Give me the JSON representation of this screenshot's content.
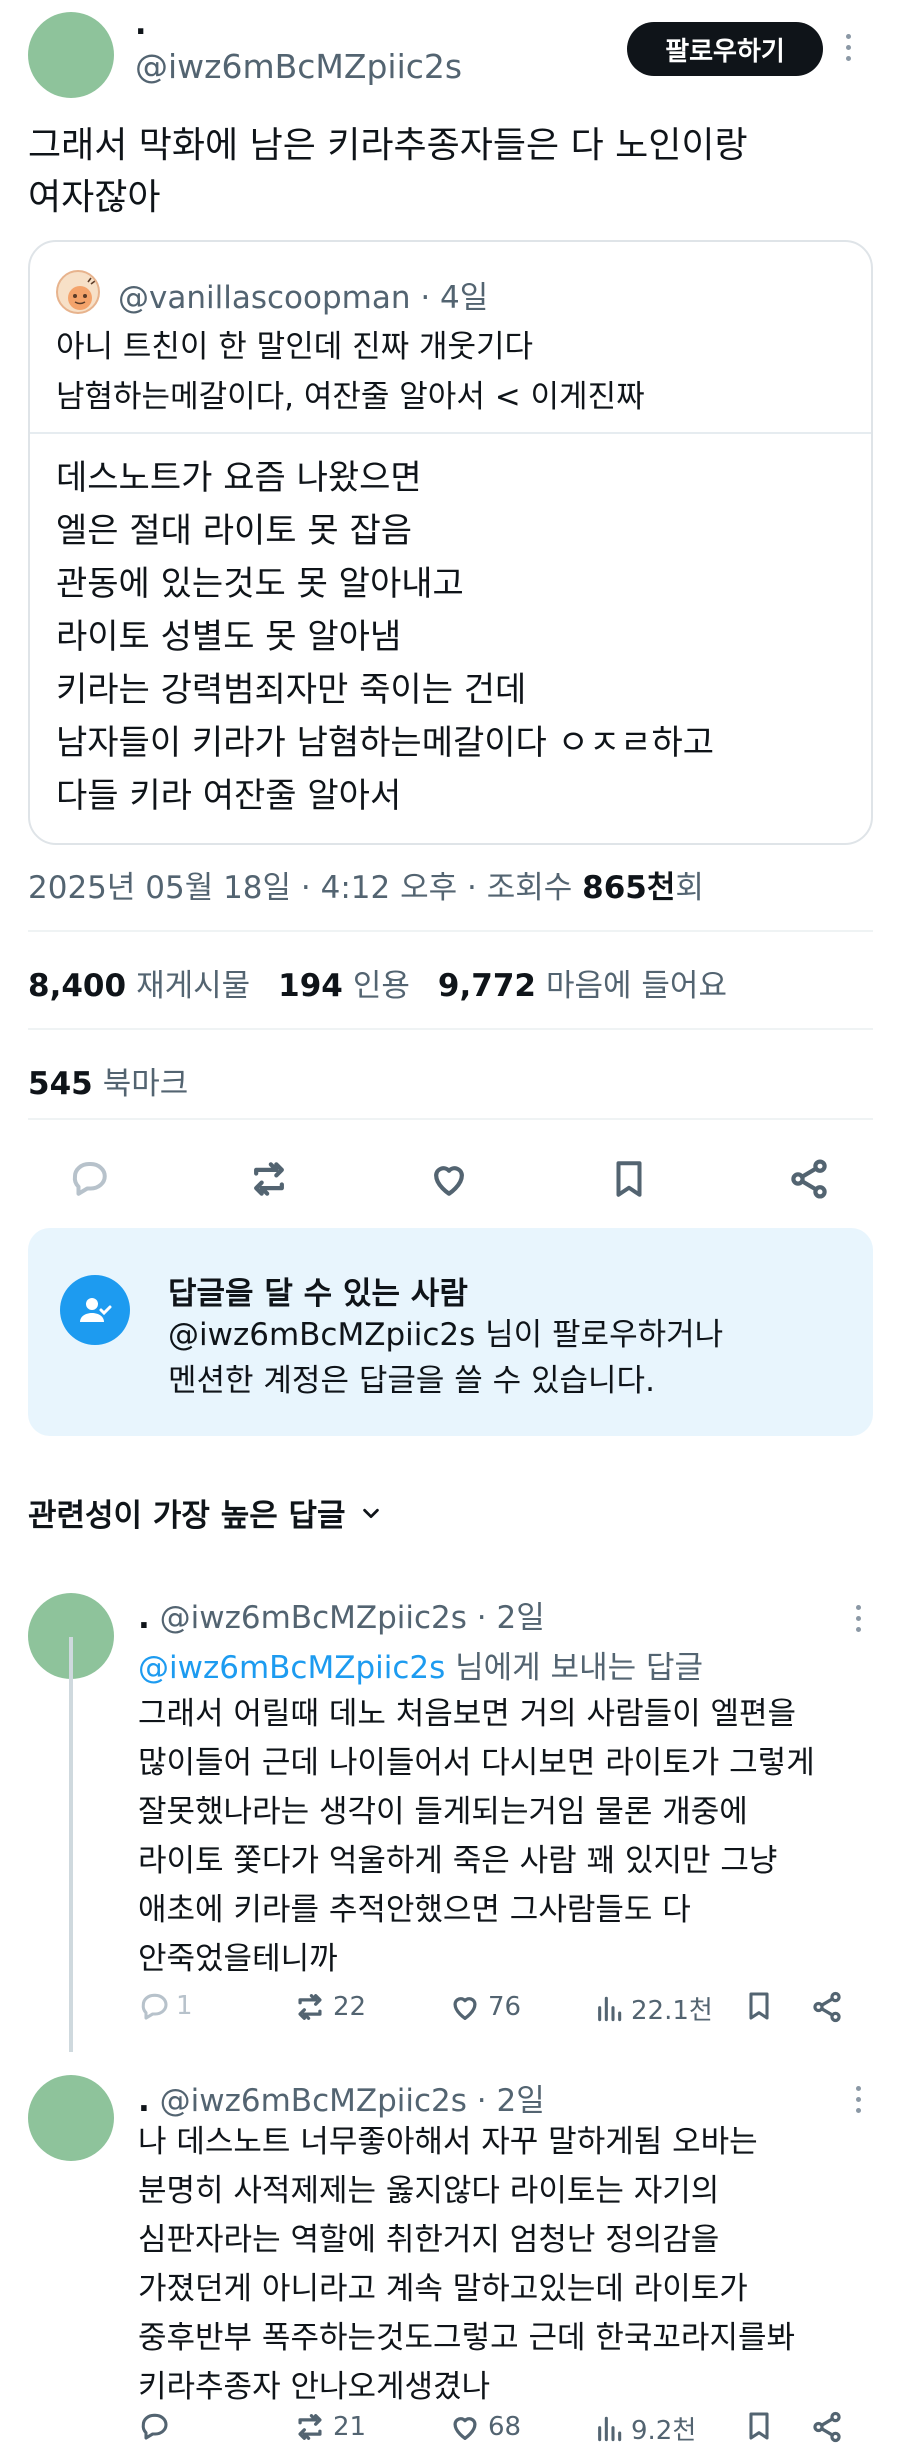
{
  "author": {
    "name": ".",
    "handle": "@iwz6mBcMZpiic2s"
  },
  "follow_label": "팔로우하기",
  "tweet": {
    "lines": [
      "그래서 막화에 남은 키라추종자들은 다 노인이랑",
      "여자잖아"
    ]
  },
  "quote": {
    "handle": "@vanillascoopman",
    "time": "· 4일",
    "lines": [
      "아니 트친이 한 말인데 진짜 개웃기다",
      "남혐하는메갈이다, 여잔줄 알아서 < 이게진짜"
    ],
    "body": [
      "데스노트가 요즘 나왔으면",
      "엘은 절대 라이토 못 잡음",
      "관동에 있는것도 못 알아내고",
      "라이토 성별도 못 알아냄",
      "키라는 강력범죄자만 죽이는 건데",
      "남자들이 키라가 남혐하는메갈이다 ㅇㅈㄹ하고",
      "다들 키라 여잔줄 알아서"
    ]
  },
  "meta": {
    "date": "2025년 05월 18일",
    "time": "4:12 오후",
    "views_label": "조회수",
    "views": "865천",
    "views_suffix": "회"
  },
  "stats": {
    "retweets": "8,400",
    "retweets_label": "재게시물",
    "quotes": "194",
    "quotes_label": "인용",
    "likes": "9,772",
    "likes_label": "마음에 들어요",
    "bookmarks": "545",
    "bookmarks_label": "북마크"
  },
  "reply_box": {
    "title": "답글을 달 수 있는 사람",
    "desc_line1": "@iwz6mBcMZpiic2s 님이 팔로우하거나",
    "desc_line2": "멘션한 계정은 답글을 쓸 수 있습니다."
  },
  "sort_label": "관련성이 가장 높은 답글",
  "replies": [
    {
      "name": ".",
      "handle": "@iwz6mBcMZpiic2s",
      "time": "· 2일",
      "to_handle": "@iwz6mBcMZpiic2s",
      "to_suffix": "님에게 보내는 답글",
      "lines": [
        "그래서 어릴때 데노 처음보면 거의 사람들이 엘편을",
        "많이들어 근데 나이들어서 다시보면 라이토가 그렇게",
        "잘못했나라는 생각이 들게되는거임 물론 개중에",
        "라이토 쫓다가 억울하게 죽은 사람 꽤 있지만 그냥",
        "애초에 키라를 추적안했으면 그사람들도 다",
        "안죽었을테니까"
      ],
      "replies": "1",
      "retweets": "22",
      "likes": "76",
      "views": "22.1천"
    },
    {
      "name": ".",
      "handle": "@iwz6mBcMZpiic2s",
      "time": "· 2일",
      "lines": [
        "나 데스노트 너무좋아해서 자꾸 말하게됨 오바는",
        "분명히 사적제제는 옳지않다 라이토는 자기의",
        "심판자라는 역할에 취한거지 엄청난 정의감을",
        "가졌던게 아니라고 계속 말하고있는데 라이토가",
        "중후반부 폭주하는것도그렇고 근데 한국꼬라지를봐",
        "키라추종자 안나오게생겼나"
      ],
      "replies": "",
      "retweets": "21",
      "likes": "68",
      "views": "9.2천"
    }
  ]
}
